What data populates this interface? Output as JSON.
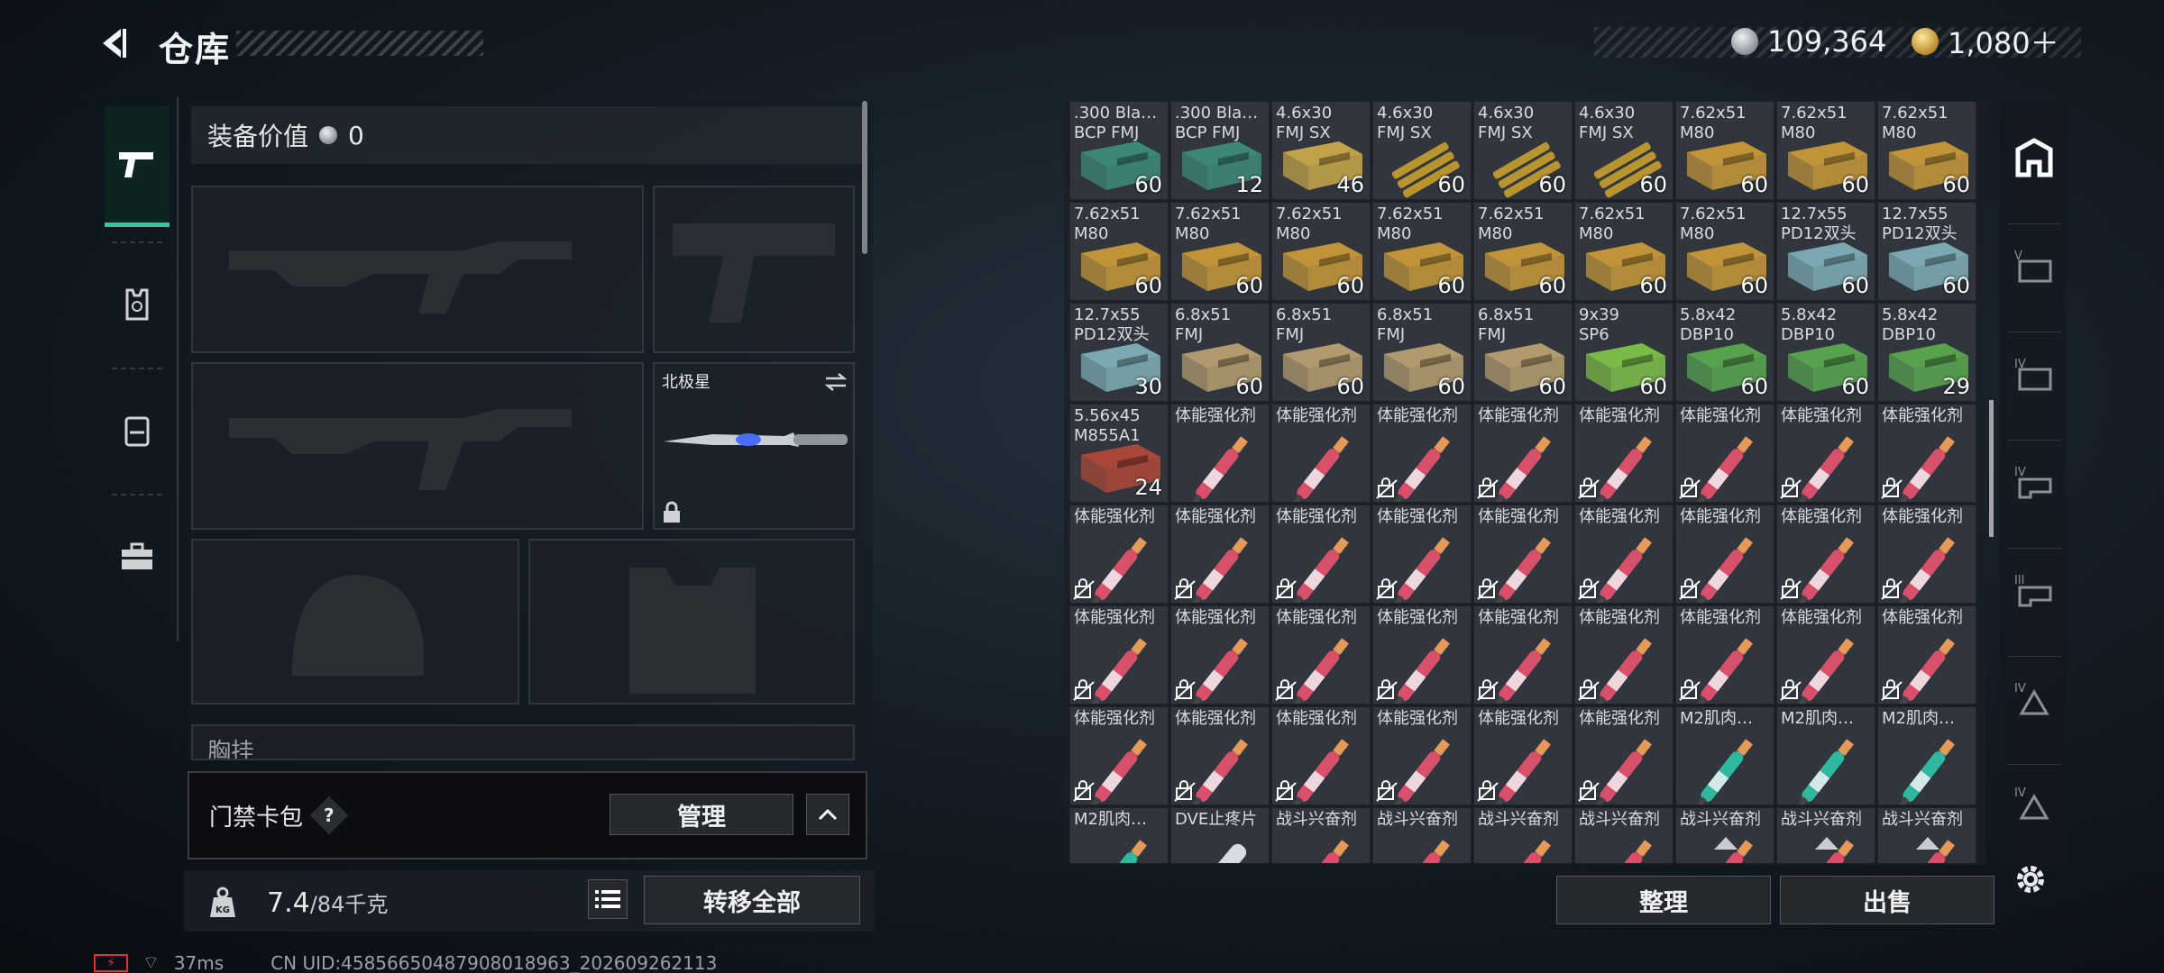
{
  "header": {
    "title": "仓库",
    "currency1": "109,364",
    "currency2": "1,080＋"
  },
  "loadout": {
    "equip_value_label": "装备价值",
    "equip_value": "0",
    "melee_name": "北极星",
    "chest_label": "胸挂",
    "keycard_label": "门禁卡包",
    "keycard_help": "?",
    "manage_label": "管理",
    "weight": "7.4",
    "weight_max": "/84千克",
    "transfer_all_label": "转移全部",
    "kg_badge": "KG"
  },
  "actions": {
    "sort_label": "整理",
    "sell_label": "出售"
  },
  "status": {
    "ping": "37ms",
    "uid": "CN UID:4585665048790801​8963_202609262113"
  },
  "colors": {
    "accent": "#2fc99a",
    "ammo_green": "#3e8c7a",
    "ammo_gold": "#c99a3a",
    "ammo_blue": "#7fb0b8",
    "ammo_lime": "#7ec24a",
    "ammo_red": "#b04a3a",
    "stim_pink": "#d8506a",
    "stim_teal": "#2fb8a0"
  },
  "items": [
    {
      "name": ".300 Bla…\nBCP FMJ",
      "count": "60",
      "kind": "ammo",
      "color": "#3e8c7a"
    },
    {
      "name": ".300 Bla…\nBCP FMJ",
      "count": "12",
      "kind": "ammo",
      "color": "#3e8c7a"
    },
    {
      "name": "4.6x30\nFMJ SX",
      "count": "46",
      "kind": "ammo",
      "color": "#c9a84a"
    },
    {
      "name": "4.6x30\nFMJ SX",
      "count": "60",
      "kind": "bullets",
      "color": "#b8952e"
    },
    {
      "name": "4.6x30\nFMJ SX",
      "count": "60",
      "kind": "bullets",
      "color": "#b8952e"
    },
    {
      "name": "4.6x30\nFMJ SX",
      "count": "60",
      "kind": "bullets",
      "color": "#b8952e"
    },
    {
      "name": "7.62x51\nM80",
      "count": "60",
      "kind": "ammo",
      "color": "#c99a3a"
    },
    {
      "name": "7.62x51\nM80",
      "count": "60",
      "kind": "ammo",
      "color": "#c99a3a"
    },
    {
      "name": "7.62x51\nM80",
      "count": "60",
      "kind": "ammo",
      "color": "#c99a3a"
    },
    {
      "name": "7.62x51\nM80",
      "count": "60",
      "kind": "ammo",
      "color": "#c99a3a"
    },
    {
      "name": "7.62x51\nM80",
      "count": "60",
      "kind": "ammo",
      "color": "#c99a3a"
    },
    {
      "name": "7.62x51\nM80",
      "count": "60",
      "kind": "ammo",
      "color": "#c99a3a"
    },
    {
      "name": "7.62x51\nM80",
      "count": "60",
      "kind": "ammo",
      "color": "#c99a3a"
    },
    {
      "name": "7.62x51\nM80",
      "count": "60",
      "kind": "ammo",
      "color": "#c99a3a"
    },
    {
      "name": "7.62x51\nM80",
      "count": "60",
      "kind": "ammo",
      "color": "#c99a3a"
    },
    {
      "name": "7.62x51\nM80",
      "count": "60",
      "kind": "ammo",
      "color": "#c99a3a"
    },
    {
      "name": "12.7x55\nPD12双头",
      "count": "60",
      "kind": "ammo",
      "color": "#7fb0b8"
    },
    {
      "name": "12.7x55\nPD12双头",
      "count": "60",
      "kind": "ammo",
      "color": "#7fb0b8"
    },
    {
      "name": "12.7x55\nPD12双头",
      "count": "30",
      "kind": "ammo",
      "color": "#7fb0b8"
    },
    {
      "name": "6.8x51\nFMJ",
      "count": "60",
      "kind": "ammo",
      "color": "#b8a070"
    },
    {
      "name": "6.8x51\nFMJ",
      "count": "60",
      "kind": "ammo",
      "color": "#b8a070"
    },
    {
      "name": "6.8x51\nFMJ",
      "count": "60",
      "kind": "ammo",
      "color": "#b8a070"
    },
    {
      "name": "6.8x51\nFMJ",
      "count": "60",
      "kind": "ammo",
      "color": "#b8a070"
    },
    {
      "name": "9x39\nSP6",
      "count": "60",
      "kind": "ammo",
      "color": "#7ec24a"
    },
    {
      "name": "5.8x42\nDBP10",
      "count": "60",
      "kind": "ammo",
      "color": "#5aa850"
    },
    {
      "name": "5.8x42\nDBP10",
      "count": "60",
      "kind": "ammo",
      "color": "#5aa850"
    },
    {
      "name": "5.8x42\nDBP10",
      "count": "29",
      "kind": "ammo",
      "color": "#5aa850"
    },
    {
      "name": "5.56x45\nM855A1",
      "count": "24",
      "kind": "ammo",
      "color": "#b04a3a"
    },
    {
      "name": "体能强化剂",
      "kind": "stim",
      "color": "#d8506a"
    },
    {
      "name": "体能强化剂",
      "kind": "stim",
      "color": "#d8506a"
    },
    {
      "name": "体能强化剂",
      "kind": "stim",
      "color": "#d8506a",
      "lock": true
    },
    {
      "name": "体能强化剂",
      "kind": "stim",
      "color": "#d8506a",
      "lock": true
    },
    {
      "name": "体能强化剂",
      "kind": "stim",
      "color": "#d8506a",
      "lock": true
    },
    {
      "name": "体能强化剂",
      "kind": "stim",
      "color": "#d8506a",
      "lock": true
    },
    {
      "name": "体能强化剂",
      "kind": "stim",
      "color": "#d8506a",
      "lock": true
    },
    {
      "name": "体能强化剂",
      "kind": "stim",
      "color": "#d8506a",
      "lock": true
    },
    {
      "name": "体能强化剂",
      "kind": "stim",
      "color": "#d8506a",
      "lock": true
    },
    {
      "name": "体能强化剂",
      "kind": "stim",
      "color": "#d8506a",
      "lock": true
    },
    {
      "name": "体能强化剂",
      "kind": "stim",
      "color": "#d8506a",
      "lock": true
    },
    {
      "name": "体能强化剂",
      "kind": "stim",
      "color": "#d8506a",
      "lock": true
    },
    {
      "name": "体能强化剂",
      "kind": "stim",
      "color": "#d8506a",
      "lock": true
    },
    {
      "name": "体能强化剂",
      "kind": "stim",
      "color": "#d8506a",
      "lock": true
    },
    {
      "name": "体能强化剂",
      "kind": "stim",
      "color": "#d8506a",
      "lock": true
    },
    {
      "name": "体能强化剂",
      "kind": "stim",
      "color": "#d8506a",
      "lock": true
    },
    {
      "name": "体能强化剂",
      "kind": "stim",
      "color": "#d8506a",
      "lock": true
    },
    {
      "name": "体能强化剂",
      "kind": "stim",
      "color": "#d8506a",
      "lock": true
    },
    {
      "name": "体能强化剂",
      "kind": "stim",
      "color": "#d8506a",
      "lock": true
    },
    {
      "name": "体能强化剂",
      "kind": "stim",
      "color": "#d8506a",
      "lock": true
    },
    {
      "name": "体能强化剂",
      "kind": "stim",
      "color": "#d8506a",
      "lock": true
    },
    {
      "name": "体能强化剂",
      "kind": "stim",
      "color": "#d8506a",
      "lock": true
    },
    {
      "name": "体能强化剂",
      "kind": "stim",
      "color": "#d8506a",
      "lock": true
    },
    {
      "name": "体能强化剂",
      "kind": "stim",
      "color": "#d8506a",
      "lock": true
    },
    {
      "name": "体能强化剂",
      "kind": "stim",
      "color": "#d8506a",
      "lock": true
    },
    {
      "name": "体能强化剂",
      "kind": "stim",
      "color": "#d8506a",
      "lock": true
    },
    {
      "name": "体能强化剂",
      "kind": "stim",
      "color": "#d8506a",
      "lock": true
    },
    {
      "name": "体能强化剂",
      "kind": "stim",
      "color": "#d8506a",
      "lock": true
    },
    {
      "name": "体能强化剂",
      "kind": "stim",
      "color": "#d8506a",
      "lock": true
    },
    {
      "name": "体能强化剂",
      "kind": "stim",
      "color": "#d8506a",
      "lock": true
    },
    {
      "name": "体能强化剂",
      "kind": "stim",
      "color": "#d8506a",
      "lock": true
    },
    {
      "name": "体能强化剂",
      "kind": "stim",
      "color": "#d8506a",
      "lock": true
    },
    {
      "name": "M2肌肉…",
      "kind": "stim",
      "color": "#2fb8a0"
    },
    {
      "name": "M2肌肉…",
      "kind": "stim",
      "color": "#2fb8a0"
    },
    {
      "name": "M2肌肉…",
      "kind": "stim",
      "color": "#2fb8a0"
    },
    {
      "name": "M2肌肉…",
      "kind": "stim",
      "color": "#2fb8a0"
    },
    {
      "name": "DVE止疼片",
      "kind": "pill",
      "color": "#9aa0a6"
    },
    {
      "name": "战斗兴奋剂",
      "kind": "stim",
      "color": "#d8506a"
    },
    {
      "name": "战斗兴奋剂",
      "kind": "stim",
      "color": "#d8506a"
    },
    {
      "name": "战斗兴奋剂",
      "kind": "stim",
      "color": "#d8506a"
    },
    {
      "name": "战斗兴奋剂",
      "kind": "stim",
      "color": "#d8506a"
    },
    {
      "name": "战斗兴奋剂",
      "kind": "stim",
      "color": "#d8506a",
      "tri": true
    },
    {
      "name": "战斗兴奋剂",
      "kind": "stim",
      "color": "#d8506a",
      "tri": true
    },
    {
      "name": "战斗兴奋剂",
      "kind": "stim",
      "color": "#d8506a",
      "tri": true
    }
  ]
}
